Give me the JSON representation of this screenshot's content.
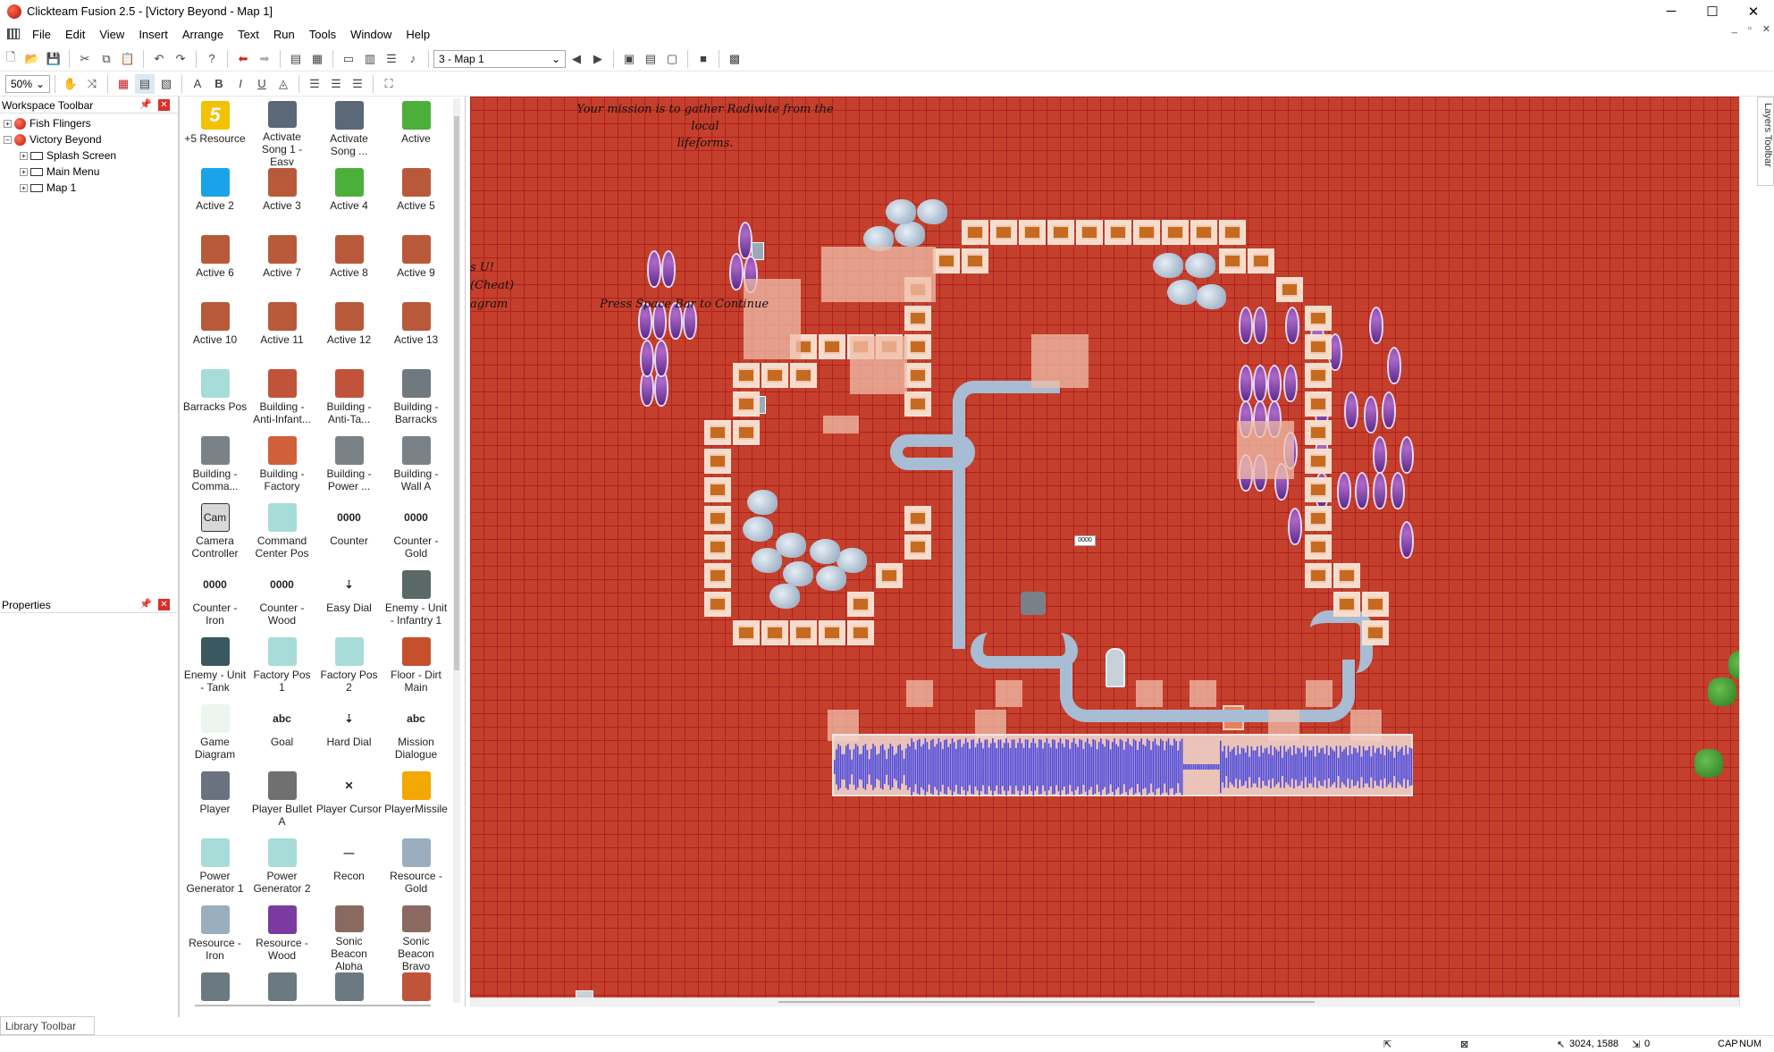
{
  "window": {
    "title": "Clickteam Fusion 2.5 - [Victory Beyond - Map 1]",
    "minimize_icon": "─",
    "maximize_icon": "☐",
    "close_icon": "✕"
  },
  "menu": {
    "items": [
      "File",
      "Edit",
      "View",
      "Insert",
      "Arrange",
      "Text",
      "Run",
      "Tools",
      "Window",
      "Help"
    ],
    "mdi_controls": [
      "_",
      "▫",
      "✕"
    ]
  },
  "toolbar1": {
    "frame_select": "3 - Map 1"
  },
  "toolbar2": {
    "zoom": "50%"
  },
  "workspace": {
    "title": "Workspace Toolbar",
    "pin_icon": "📌",
    "close_icon": "✕",
    "tree": [
      {
        "label": "Fish Flingers",
        "level": 0,
        "type": "app",
        "expander": "+"
      },
      {
        "label": "Victory Beyond",
        "level": 0,
        "type": "app",
        "expander": "−"
      },
      {
        "label": "Splash Screen",
        "level": 1,
        "type": "frame",
        "expander": "+"
      },
      {
        "label": "Main Menu",
        "level": 1,
        "type": "frame",
        "expander": "+"
      },
      {
        "label": "Map 1",
        "level": 1,
        "type": "frame",
        "expander": "+"
      }
    ]
  },
  "properties": {
    "title": "Properties",
    "pin_icon": "📌",
    "close_icon": "✕"
  },
  "library": {
    "tab_label": "Library Toolbar",
    "items": [
      {
        "label": "+5 Resource",
        "thumb": "5",
        "color": "#f2c200"
      },
      {
        "label": "Activate Song 1 - Easy",
        "thumb": "",
        "color": "#5a6878"
      },
      {
        "label": "Activate Song ...",
        "thumb": "",
        "color": "#5a6878"
      },
      {
        "label": "Active",
        "thumb": "",
        "color": "#4caf3a"
      },
      {
        "label": "Active 2",
        "thumb": "",
        "color": "#1aa3e8"
      },
      {
        "label": "Active 3",
        "thumb": "",
        "color": "#b85a3a"
      },
      {
        "label": "Active 4",
        "thumb": "",
        "color": "#4caf3a"
      },
      {
        "label": "Active 5",
        "thumb": "",
        "color": "#b85a3a"
      },
      {
        "label": "Active 6",
        "thumb": "",
        "color": "#b85a3a"
      },
      {
        "label": "Active 7",
        "thumb": "",
        "color": "#b85a3a"
      },
      {
        "label": "Active 8",
        "thumb": "",
        "color": "#b85a3a"
      },
      {
        "label": "Active 9",
        "thumb": "",
        "color": "#b85a3a"
      },
      {
        "label": "Active 10",
        "thumb": "",
        "color": "#b85a3a"
      },
      {
        "label": "Active 11",
        "thumb": "",
        "color": "#b85a3a"
      },
      {
        "label": "Active 12",
        "thumb": "",
        "color": "#b85a3a"
      },
      {
        "label": "Active 13",
        "thumb": "",
        "color": "#b85a3a"
      },
      {
        "label": "Barracks Pos",
        "thumb": "",
        "color": "#a8dcd8"
      },
      {
        "label": "Building - Anti-Infant...",
        "thumb": "",
        "color": "#c0533a"
      },
      {
        "label": "Building - Anti-Ta...",
        "thumb": "",
        "color": "#c0533a"
      },
      {
        "label": "Building - Barracks",
        "thumb": "",
        "color": "#707880"
      },
      {
        "label": "Building - Comma...",
        "thumb": "",
        "color": "#7a8288"
      },
      {
        "label": "Building - Factory",
        "thumb": "",
        "color": "#d0603a"
      },
      {
        "label": "Building - Power ...",
        "thumb": "",
        "color": "#7a8288"
      },
      {
        "label": "Building - Wall A",
        "thumb": "",
        "color": "#7a8288"
      },
      {
        "label": "Camera Controller",
        "thumb": "Cam",
        "color": "#d8d8d8"
      },
      {
        "label": "Command Center Pos",
        "thumb": "",
        "color": "#a8dcd8"
      },
      {
        "label": "Counter",
        "thumb": "0000",
        "color": ""
      },
      {
        "label": "Counter - Gold",
        "thumb": "0000",
        "color": ""
      },
      {
        "label": "Counter - Iron",
        "thumb": "0000",
        "color": ""
      },
      {
        "label": "Counter - Wood",
        "thumb": "0000",
        "color": ""
      },
      {
        "label": "Easy Dial",
        "thumb": "⇣",
        "color": ""
      },
      {
        "label": "Enemy - Unit - Infantry 1",
        "thumb": "",
        "color": "#5a6868"
      },
      {
        "label": "Enemy - Unit - Tank",
        "thumb": "",
        "color": "#3a5860"
      },
      {
        "label": "Factory Pos 1",
        "thumb": "",
        "color": "#a8dcd8"
      },
      {
        "label": "Factory Pos 2",
        "thumb": "",
        "color": "#a8dcd8"
      },
      {
        "label": "Floor - Dirt Main",
        "thumb": "",
        "color": "#c4502c"
      },
      {
        "label": "Game Diagram",
        "thumb": "",
        "color": "#eef4ee"
      },
      {
        "label": "Goal",
        "thumb": "abc",
        "color": ""
      },
      {
        "label": "Hard Dial",
        "thumb": "⇣",
        "color": ""
      },
      {
        "label": "Mission Dialogue",
        "thumb": "abc",
        "color": ""
      },
      {
        "label": "Player",
        "thumb": "",
        "color": "#6a7280"
      },
      {
        "label": "Player Bullet A",
        "thumb": "",
        "color": "#707070"
      },
      {
        "label": "Player Cursor",
        "thumb": "✕",
        "color": ""
      },
      {
        "label": "PlayerMissile",
        "thumb": "",
        "color": "#f2a800"
      },
      {
        "label": "Power Generator 1",
        "thumb": "",
        "color": "#a8dcd8"
      },
      {
        "label": "Power Generator 2",
        "thumb": "",
        "color": "#a8dcd8"
      },
      {
        "label": "Recon",
        "thumb": "—",
        "color": ""
      },
      {
        "label": "Resource - Gold",
        "thumb": "",
        "color": "#9aaec0"
      },
      {
        "label": "Resource - Iron",
        "thumb": "",
        "color": "#9aaec0"
      },
      {
        "label": "Resource - Wood",
        "thumb": "",
        "color": "#7a3aa0"
      },
      {
        "label": "Sonic Beacon Alpha",
        "thumb": "",
        "color": "#8a6a60"
      },
      {
        "label": "Sonic Beacon Bravo",
        "thumb": "",
        "color": "#8a6a60"
      },
      {
        "label": "",
        "thumb": "",
        "color": "#6a7a80"
      },
      {
        "label": "",
        "thumb": "",
        "color": "#6a7a80"
      },
      {
        "label": "",
        "thumb": "",
        "color": "#6a7a80"
      },
      {
        "label": "",
        "thumb": "",
        "color": "#c0533a"
      }
    ]
  },
  "frame": {
    "mission_text": "Your mission is to gather Radiwite from the local\nlifeforms.",
    "press_space": "Press Space Bar to Continue",
    "cut_text_1": "s U!",
    "cut_text_2": "(Cheat)",
    "cut_text_3": "agram",
    "counter_label": "0000"
  },
  "layers_toolbar": "Layers Toolbar",
  "status": {
    "coords": "3024, 1588",
    "count": "0",
    "caps": "CAP",
    "num": "NUM"
  }
}
